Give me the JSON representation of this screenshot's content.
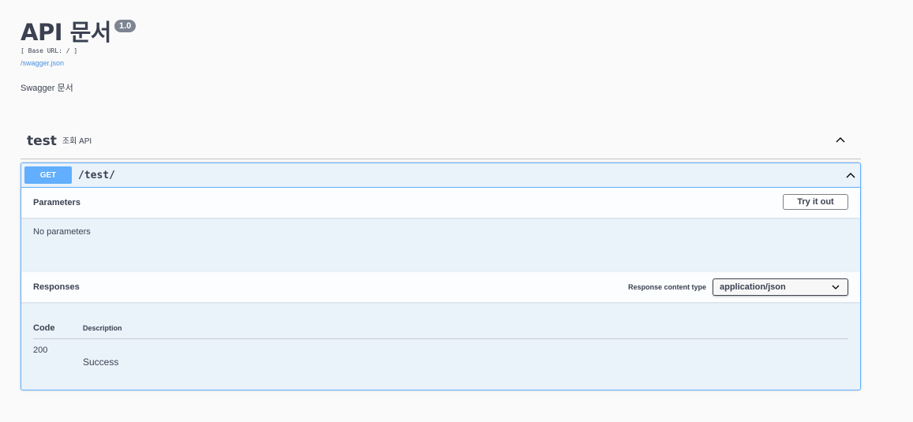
{
  "info": {
    "title": "API 문서",
    "version": "1.0",
    "base_url": "[ Base URL: / ]",
    "spec_link": "/swagger.json",
    "description": "Swagger 문서"
  },
  "tag": {
    "name": "test",
    "description": "조회 API",
    "toggle_icon": "chevron-up-icon"
  },
  "operation": {
    "method": "GET",
    "path": "/test/",
    "method_color": "#61affe",
    "toggle_icon": "chevron-up-icon"
  },
  "parameters": {
    "title": "Parameters",
    "try_button": "Try it out",
    "empty_text": "No parameters"
  },
  "responses": {
    "title": "Responses",
    "content_type_label": "Response content type",
    "content_type_value": "application/json",
    "columns": {
      "code": "Code",
      "description": "Description"
    },
    "rows": [
      {
        "code": "200",
        "description": "Success"
      }
    ]
  }
}
